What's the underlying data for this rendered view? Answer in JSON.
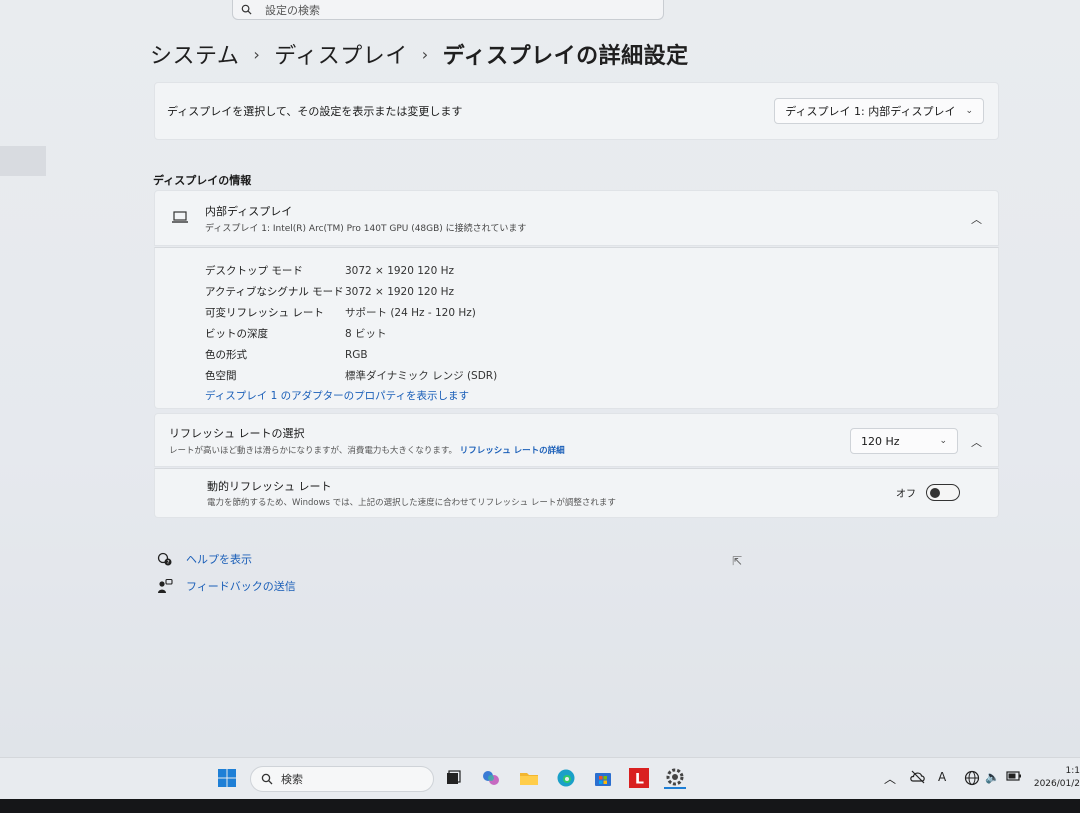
{
  "search": {
    "placeholder": "設定の検索"
  },
  "breadcrumb": {
    "items": [
      "システム",
      "ディスプレイ"
    ],
    "current": "ディスプレイの詳細設定",
    "separator": "›"
  },
  "display_select": {
    "label": "ディスプレイを選択して、その設定を表示または変更します",
    "value": "ディスプレイ 1: 内部ディスプレイ"
  },
  "info_section": {
    "title": "ディスプレイの情報",
    "device_name": "内部ディスプレイ",
    "device_desc": "ディスプレイ 1: Intel(R) Arc(TM) Pro 140T GPU (48GB) に接続されています",
    "rows": [
      {
        "key": "デスクトップ モード",
        "value": "3072 × 1920 120 Hz"
      },
      {
        "key": "アクティブなシグナル モード",
        "value": "3072 × 1920 120 Hz"
      },
      {
        "key": "可変リフレッシュ レート",
        "value": "サポート (24 Hz - 120 Hz)"
      },
      {
        "key": "ビットの深度",
        "value": "8 ビット"
      },
      {
        "key": "色の形式",
        "value": "RGB"
      },
      {
        "key": "色空間",
        "value": "標準ダイナミック レンジ (SDR)"
      }
    ],
    "adapter_link": "ディスプレイ 1 のアダプターのプロパティを表示します"
  },
  "refresh": {
    "title": "リフレッシュ レートの選択",
    "desc": "レートが高いほど動きは滑らかになりますが、消費電力も大きくなります。",
    "desc_link": "リフレッシュ レートの詳細",
    "value": "120 Hz"
  },
  "dynamic_refresh": {
    "title": "動的リフレッシュ レート",
    "desc": "電力を節約するため、Windows では、上記の選択した速度に合わせてリフレッシュ レートが調整されます",
    "toggle_label": "オフ",
    "toggle_on": false
  },
  "help_links": {
    "help": "ヘルプを表示",
    "feedback": "フィードバックの送信"
  },
  "taskbar": {
    "search_label": "検索",
    "clock_time": "1:1",
    "clock_date": "2026/01/2",
    "ime": "A"
  },
  "colors": {
    "accent": "#1b5fb8",
    "background": "#e9ecef",
    "card": "#f2f4f6"
  }
}
